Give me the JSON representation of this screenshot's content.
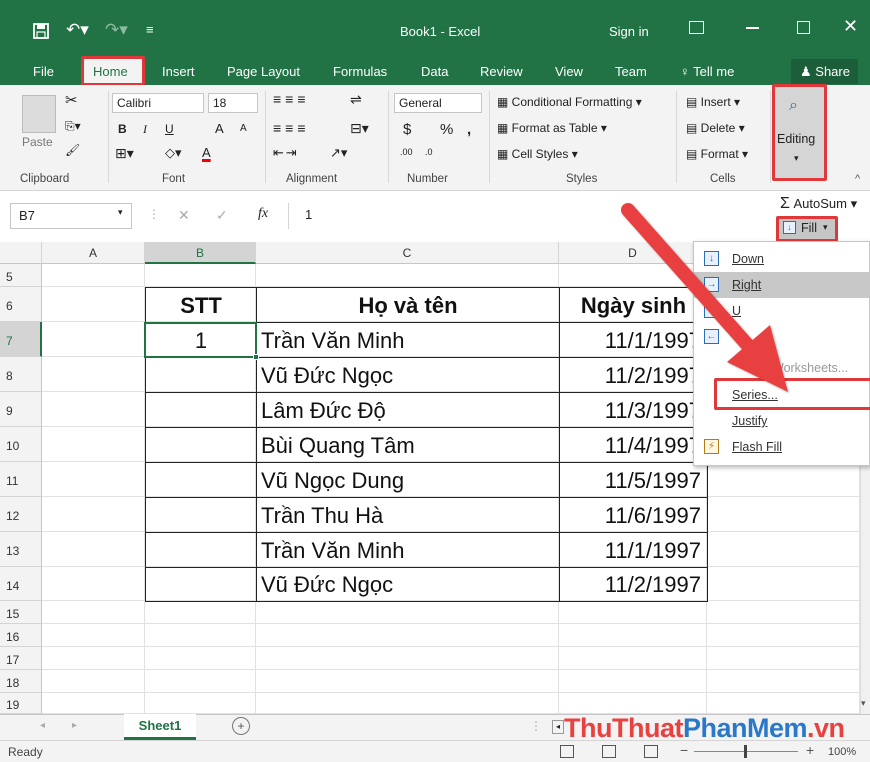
{
  "title": {
    "document": "Book1 - Excel",
    "sign_in": "Sign in",
    "save_icon": "save-icon",
    "undo_icon": "undo-icon",
    "redo_icon": "redo-icon",
    "quick_access_icon": "customize-icon",
    "ribbon_display_icon": "ribbon-display-icon"
  },
  "tabs": [
    "File",
    "Home",
    "Insert",
    "Page Layout",
    "Formulas",
    "Data",
    "Review",
    "View",
    "Team"
  ],
  "tell_me": "Tell me",
  "share": "Share",
  "ribbon": {
    "clipboard": {
      "label": "Clipboard",
      "paste": "Paste"
    },
    "font": {
      "label": "Font",
      "name": "Calibri",
      "size": "18",
      "bold": "B",
      "italic": "I",
      "underline": "U",
      "grow": "A",
      "shrink": "A",
      "color": "A"
    },
    "alignment": {
      "label": "Alignment"
    },
    "number": {
      "label": "Number",
      "format": "General",
      "currency": "$",
      "percent": "%",
      "comma": ",",
      "inc": ".00",
      "dec": ".0"
    },
    "styles": {
      "label": "Styles",
      "conditional": "Conditional Formatting",
      "format_table": "Format as Table",
      "cell_styles": "Cell Styles"
    },
    "cells": {
      "label": "Cells",
      "insert": "Insert",
      "delete": "Delete",
      "format": "Format"
    },
    "editing": {
      "label": "Editing",
      "autosum": "AutoSum",
      "fill": "Fill"
    }
  },
  "formula_bar": {
    "name_box": "B7",
    "cancel": "✕",
    "enter": "✓",
    "fx": "fx",
    "value": "1"
  },
  "columns": [
    "A",
    "B",
    "C",
    "D"
  ],
  "rows": [
    "5",
    "6",
    "7",
    "8",
    "9",
    "10",
    "11",
    "12",
    "13",
    "14",
    "15",
    "16",
    "17",
    "18",
    "19"
  ],
  "table": {
    "headers": [
      "STT",
      "Họ và tên",
      "Ngày sinh"
    ],
    "rows": [
      [
        "1",
        "Trần Văn Minh",
        "11/1/1997"
      ],
      [
        "",
        "Vũ Đức Ngọc",
        "11/2/1997"
      ],
      [
        "",
        "Lâm Đức Độ",
        "11/3/1997"
      ],
      [
        "",
        "Bùi Quang Tâm",
        "11/4/1997"
      ],
      [
        "",
        "Vũ Ngọc Dung",
        "11/5/1997"
      ],
      [
        "",
        "Trần Thu Hà",
        "11/6/1997"
      ],
      [
        "",
        "Trần Văn Minh",
        "11/1/1997"
      ],
      [
        "",
        "Vũ Đức Ngọc",
        "11/2/1997"
      ]
    ]
  },
  "fill_menu": {
    "items": [
      "Down",
      "Right",
      "Up",
      "Left",
      "Across Worksheets...",
      "Series...",
      "Justify",
      "Flash Fill"
    ],
    "visible_right": {
      "up": "U",
      "across": "Worksheets..."
    }
  },
  "sheet_tab": "Sheet1",
  "status": {
    "ready": "Ready",
    "zoom": "100%"
  },
  "watermark": "ThuThuatPhanMem.vn",
  "colors": {
    "excel_green": "#217346",
    "highlight_red": "#e0383a",
    "arrow_red": "#e8413f"
  }
}
